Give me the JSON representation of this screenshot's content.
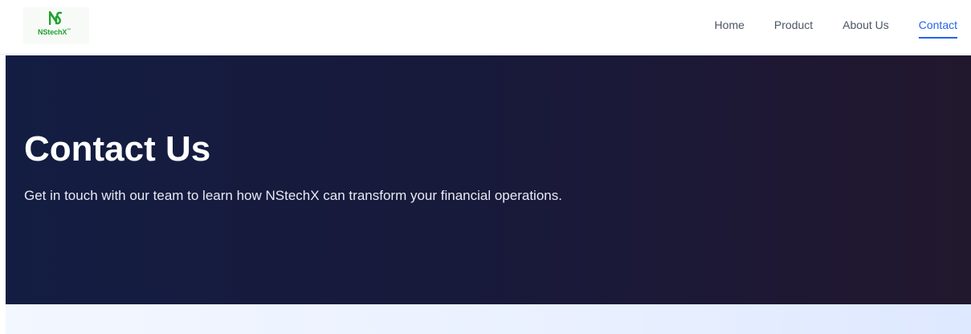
{
  "header": {
    "logo_text": "NStechX",
    "logo_tm": "™",
    "nav": [
      {
        "label": "Home",
        "active": false
      },
      {
        "label": "Product",
        "active": false
      },
      {
        "label": "About Us",
        "active": false
      },
      {
        "label": "Contact",
        "active": true
      }
    ]
  },
  "hero": {
    "title": "Contact Us",
    "subtitle": "Get in touch with our team to learn how NStechX can transform your financial operations."
  },
  "colors": {
    "brand_green": "#1fa12f",
    "accent_blue": "#2563eb",
    "hero_background": "#141c3f"
  }
}
